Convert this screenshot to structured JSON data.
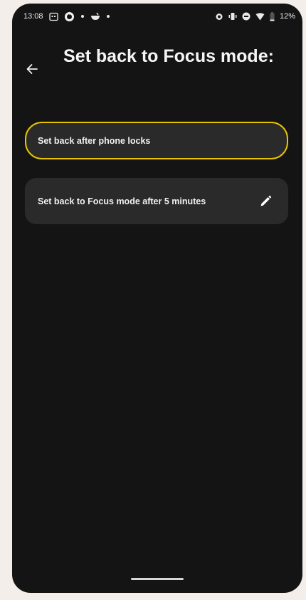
{
  "status_bar": {
    "time": "13:08",
    "battery": "12%",
    "icons_left": [
      "calendar-icon",
      "sync-icon",
      "dot-icon",
      "bowl-icon",
      "dot-icon"
    ],
    "icons_right": [
      "alarm-icon",
      "vibrate-icon",
      "dnd-icon",
      "wifi-icon",
      "battery-icon"
    ]
  },
  "header": {
    "title": "Set back to Focus mode:",
    "back_icon": "arrow-left-icon"
  },
  "options": [
    {
      "label": "Set back after phone locks",
      "selected": true
    },
    {
      "label": "Set back to Focus mode after 5 minutes",
      "selected": false,
      "action_icon": "pencil-icon"
    }
  ],
  "colors": {
    "background": "#141414",
    "card": "#2a2a2a",
    "accent": "#e6c400",
    "page_bg": "#f3eee9"
  }
}
